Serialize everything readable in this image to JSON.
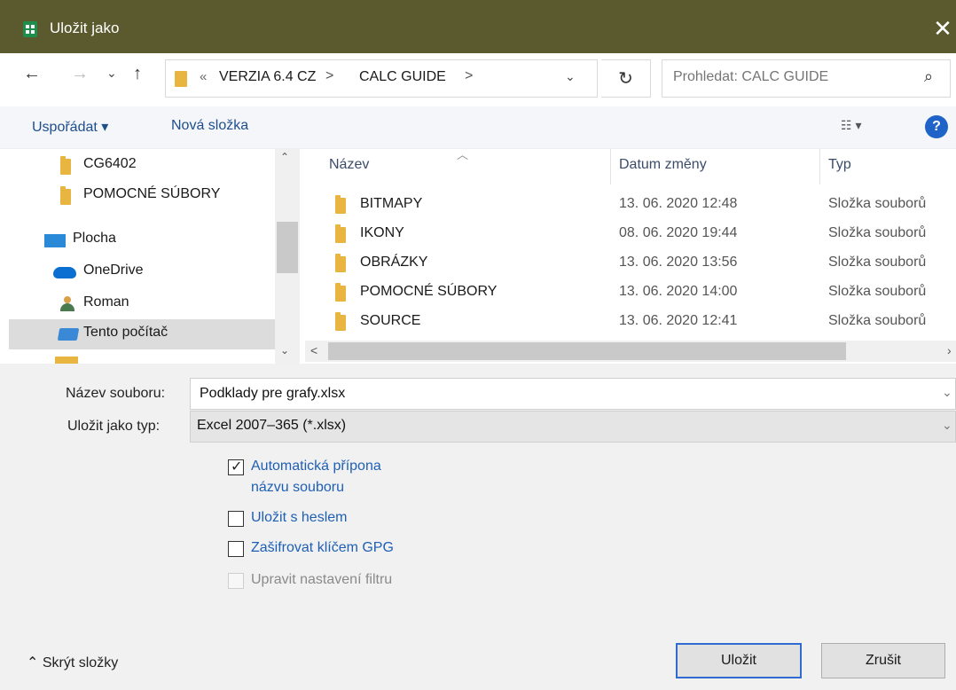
{
  "window": {
    "title": "Uložit jako",
    "close_label": "✕"
  },
  "nav": {
    "back": "←",
    "forward": "→",
    "recent": "⌄",
    "up": "↑",
    "breadcrumb_prefix": "«",
    "breadcrumb": [
      "VERZIA 6.4 CZ",
      "CALC GUIDE"
    ],
    "separator": ">",
    "refresh": "↻",
    "search_placeholder": "Prohledat: CALC GUIDE",
    "search_icon": "⌕"
  },
  "toolbar": {
    "organize": "Uspořádat ▾",
    "new_folder": "Nová složka",
    "view": "☷ ▾",
    "help": "?"
  },
  "sidebar": {
    "items": [
      {
        "label": "CG6402",
        "icon": "folder-icon"
      },
      {
        "label": "POMOCNÉ SÚBORY",
        "icon": "folder-icon"
      },
      {
        "label": "Plocha",
        "icon": "desktop-icon"
      },
      {
        "label": "OneDrive",
        "icon": "cloud-icon"
      },
      {
        "label": "Roman",
        "icon": "user-icon"
      },
      {
        "label": "Tento počítač",
        "icon": "computer-icon",
        "selected": true
      }
    ]
  },
  "filelist": {
    "columns": [
      "Název",
      "Datum změny",
      "Typ"
    ],
    "rows": [
      {
        "name": "BITMAPY",
        "date": "13. 06. 2020 12:48",
        "type": "Složka souborů"
      },
      {
        "name": "IKONY",
        "date": "08. 06. 2020 19:44",
        "type": "Složka souborů"
      },
      {
        "name": "OBRÁZKY",
        "date": "13. 06. 2020 13:56",
        "type": "Složka souborů"
      },
      {
        "name": "POMOCNÉ SÚBORY",
        "date": "13. 06. 2020 14:00",
        "type": "Složka souborů"
      },
      {
        "name": "SOURCE",
        "date": "13. 06. 2020 12:41",
        "type": "Složka souborů"
      }
    ]
  },
  "form": {
    "filename_label": "Název souboru:",
    "filename_value": "Podklady pre grafy.xlsx",
    "filetype_label": "Uložit jako typ:",
    "filetype_value": "Excel 2007–365 (*.xlsx)",
    "checkboxes": {
      "auto_ext_line1": "Automatická přípona",
      "auto_ext_line2": "názvu souboru",
      "auto_ext_checked": true,
      "password": "Uložit s heslem",
      "password_checked": false,
      "gpg": "Zašifrovat klíčem GPG",
      "gpg_checked": false,
      "filter": "Upravit nastavení filtru",
      "filter_enabled": false
    }
  },
  "footer": {
    "hide_folders": "Skrýt složky",
    "save": "Uložit",
    "cancel": "Zrušit"
  }
}
